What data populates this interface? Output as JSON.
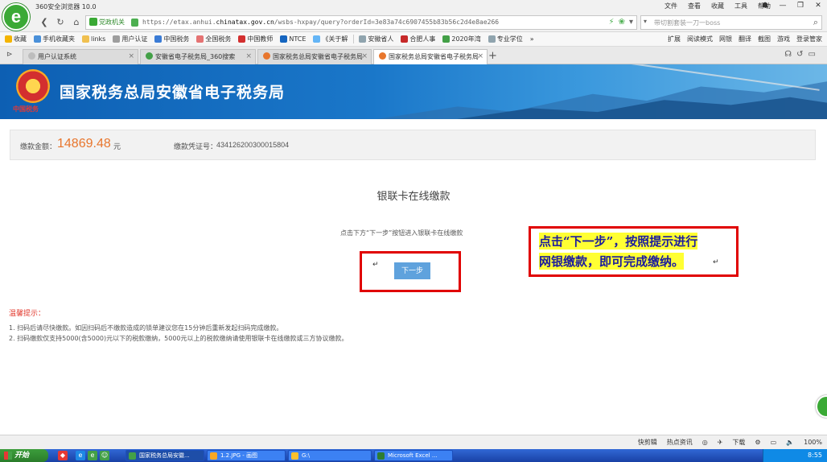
{
  "browser": {
    "title": "360安全浏览器 10.0",
    "menu": [
      "文件",
      "查看",
      "收藏",
      "工具",
      "帮助"
    ],
    "window_controls": [
      "☗",
      "—",
      "❐",
      "✕"
    ],
    "url_badge": "党政机关",
    "url_scheme": "https://",
    "url_pre": "etax.anhui.",
    "url_domain": "chinatax.gov.cn",
    "url_path": "/wsbs-hxpay/query?orderId=3e83a74c6907455b83b56c2d4e8ae266",
    "search_placeholder": "带切割套装一刀一boss"
  },
  "bookmarks": {
    "items": [
      {
        "label": "收藏",
        "color": "#f4b400"
      },
      {
        "label": "手机收藏夹",
        "color": "#4a90d9"
      },
      {
        "label": "links",
        "color": "#f0c050"
      },
      {
        "label": "用户认证",
        "color": "#9e9e9e"
      },
      {
        "label": "中国税务",
        "color": "#3a7bd5"
      },
      {
        "label": "全国税务",
        "color": "#e57373"
      },
      {
        "label": "中国教师",
        "color": "#d32f2f"
      },
      {
        "label": "NTCE",
        "color": "#1565c0"
      },
      {
        "label": "《关于解",
        "color": "#64b5f6"
      },
      {
        "label": "安徽省人",
        "color": "#90a4ae"
      },
      {
        "label": "合肥人事",
        "color": "#c62828"
      },
      {
        "label": "2020年湾",
        "color": "#43a047"
      },
      {
        "label": "专业学位",
        "color": "#90a4ae"
      }
    ],
    "more": "»",
    "right": [
      "扩展",
      "阅读模式",
      "网银",
      "翻译",
      "截图",
      "游戏",
      "登录管家"
    ]
  },
  "tabs": [
    {
      "label": "用户认证系统",
      "color": "#bdbdbd",
      "active": false
    },
    {
      "label": "安徽省电子税务局_360搜索",
      "color": "#43a047",
      "active": false
    },
    {
      "label": "国家税务总局安徽省电子税务局",
      "color": "#e8762d",
      "active": false
    },
    {
      "label": "国家税务总局安徽省电子税务局",
      "color": "#e8762d",
      "active": true
    }
  ],
  "banner": {
    "title": "国家税务总局安徽省电子税务局",
    "emblem_sub": "中国税务"
  },
  "payment": {
    "amount_label": "缴款金额：",
    "amount": "14869.48",
    "unit": "元",
    "voucher_label": "缴款凭证号：",
    "voucher": "434126200300015804"
  },
  "main": {
    "title": "银联卡在线缴款",
    "subtitle": "点击下方“下一步”按钮进入银联卡在线缴款",
    "return_mark": "↵",
    "next_label": "下一步"
  },
  "annotation": {
    "line1": "点击“下一步”，按照提示进行",
    "line2": "网银缴款，即可完成缴纳。",
    "return_mark": "↵"
  },
  "tips": {
    "title": "温馨提示：",
    "items": [
      "1. 扫码后请尽快缴款。如因扫码后不缴款造成的锁单建议您在15分钟后重新发起扫码完成缴款。",
      "2. 扫码缴款仅支持5000(含5000)元以下的税款缴纳，5000元以上的税款缴纳请使用银联卡在线缴款或三方协议缴款。"
    ]
  },
  "statusbar": {
    "items": [
      "快剪辑",
      "热点资讯",
      "下载",
      "100%"
    ]
  },
  "taskbar": {
    "start": "开始",
    "tasks": [
      {
        "label": "国家税务总局安徽...",
        "color": "#43a047",
        "active": true
      },
      {
        "label": "1.2.JPG - 画图",
        "color": "#f9a825",
        "active": false
      },
      {
        "label": "G:\\",
        "color": "#fbc02d",
        "active": false
      },
      {
        "label": "Microsoft Excel ...",
        "color": "#2e7d32",
        "active": false
      }
    ],
    "time": "8:55"
  }
}
